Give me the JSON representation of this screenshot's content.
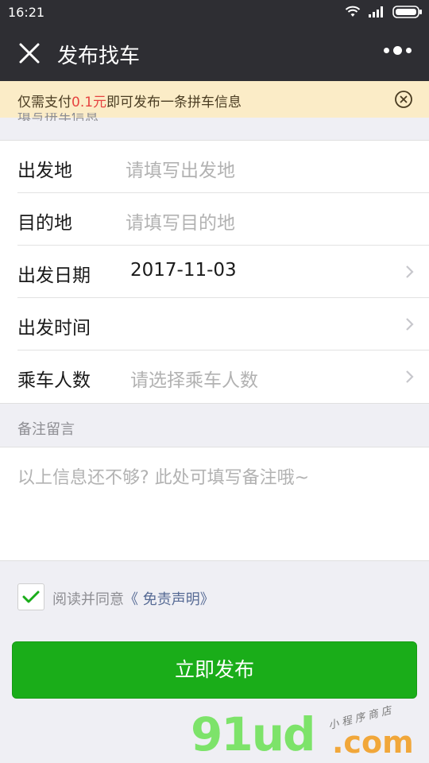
{
  "status_bar": {
    "time": "16:21"
  },
  "nav": {
    "title": "发布找车"
  },
  "notice": {
    "prefix": "仅需支付",
    "price": "0.1元",
    "suffix": "即可发布一条拼车信息"
  },
  "section_top_label": "填写拼车信息",
  "form": {
    "rows": [
      {
        "label": "出发地",
        "value": "请填写出发地",
        "is_placeholder": true,
        "has_arrow": false
      },
      {
        "label": "目的地",
        "value": "请填写目的地",
        "is_placeholder": true,
        "has_arrow": false
      },
      {
        "label": "出发日期",
        "value": "2017-11-03",
        "is_placeholder": false,
        "has_arrow": true
      },
      {
        "label": "出发时间",
        "value": "",
        "is_placeholder": false,
        "has_arrow": true
      },
      {
        "label": "乘车人数",
        "value": "请选择乘车人数",
        "is_placeholder": true,
        "has_arrow": true
      }
    ]
  },
  "remark": {
    "label": "备注留言",
    "placeholder": "以上信息还不够? 此处可填写备注哦~"
  },
  "agree": {
    "checked": true,
    "text": "阅读并同意",
    "link": "《 免责声明》"
  },
  "submit_label": "立即发布",
  "watermark": {
    "brand": "91ud",
    "tld": ".com",
    "tagline": "小程序商店"
  },
  "colors": {
    "nav_bg": "#2e2e33",
    "notice_bg": "#fbecc7",
    "accent_green": "#1aad19",
    "price_red": "#e64340",
    "link_blue": "#576b95"
  }
}
